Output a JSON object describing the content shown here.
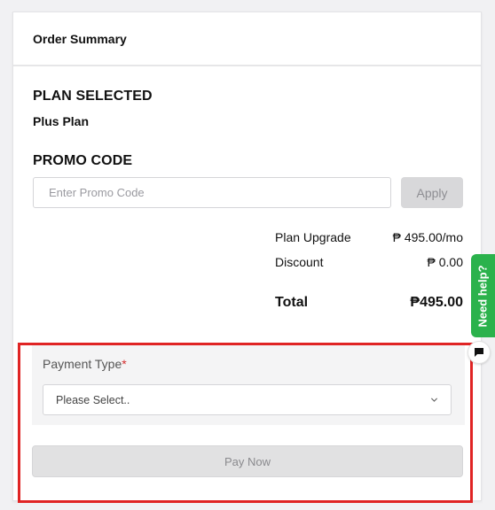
{
  "card": {
    "title": "Order Summary"
  },
  "plan": {
    "heading": "PLAN SELECTED",
    "name": "Plus Plan"
  },
  "promo": {
    "heading": "PROMO CODE",
    "placeholder": "Enter Promo Code",
    "value": "",
    "apply_label": "Apply"
  },
  "summary": {
    "rows": [
      {
        "label": "Plan Upgrade",
        "value": "₱ 495.00/mo"
      },
      {
        "label": "Discount",
        "value": "₱ 0.00"
      }
    ],
    "total_label": "Total",
    "total_value": "₱495.00"
  },
  "payment": {
    "label": "Payment Type",
    "required_mark": "*",
    "select_value": "Please Select..",
    "pay_label": "Pay Now"
  },
  "help_widget": {
    "label": "Need help?",
    "color": "#2bb24c"
  },
  "colors": {
    "highlight_frame": "#e02424",
    "required": "#d32f2f"
  }
}
